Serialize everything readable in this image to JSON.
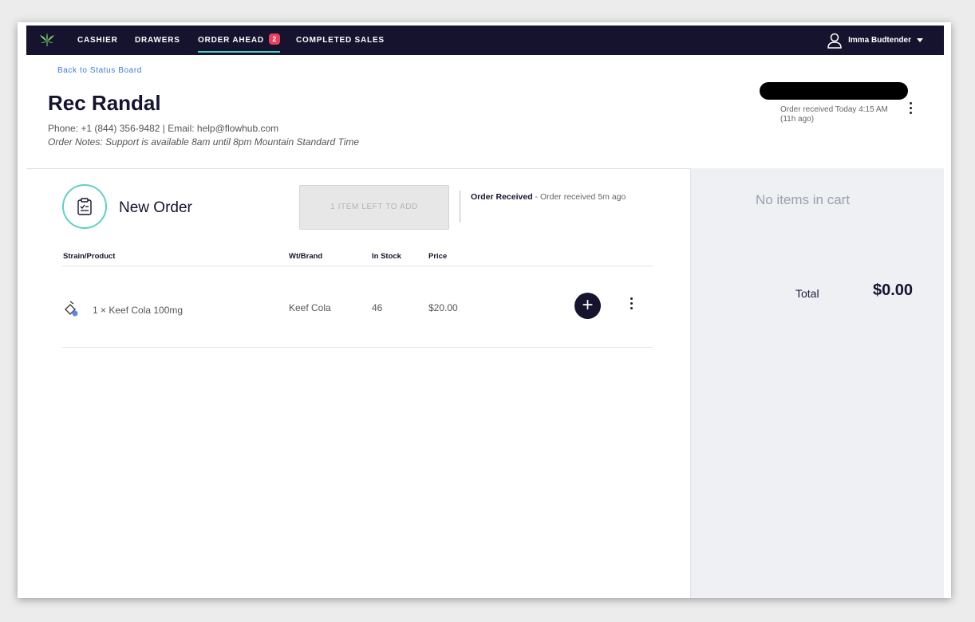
{
  "nav": {
    "items": [
      {
        "label": "CASHIER"
      },
      {
        "label": "DRAWERS"
      },
      {
        "label": "ORDER AHEAD",
        "badge": "2",
        "active": true
      },
      {
        "label": "COMPLETED SALES"
      }
    ],
    "user_name": "Imma Budtender"
  },
  "header": {
    "back_link": "Back to Status Board",
    "customer_name": "Rec Randal",
    "contact": "Phone: +1 (844) 356-9482  |  Email: help@flowhub.com",
    "notes": "Order Notes: Support is available 8am until 8pm Mountain Standard Time",
    "status_received": "Order received Today 4:15 AM (11h ago)"
  },
  "order": {
    "title": "New Order",
    "items_left_button": "1 ITEM LEFT TO ADD",
    "status_label": "Order Received",
    "status_detail": " - Order received 5m ago",
    "columns": [
      "Strain/Product",
      "Wt/Brand",
      "In Stock",
      "Price"
    ],
    "rows": [
      {
        "product": "1 × Keef Cola 100mg",
        "brand": "Keef Cola",
        "in_stock": "46",
        "price": "$20.00"
      }
    ]
  },
  "cart": {
    "empty_text": "No items in cart",
    "total_label": "Total",
    "total_value": "$0.00"
  },
  "colors": {
    "nav_bg": "#15132e",
    "accent_teal": "#4fd0bb",
    "badge_red": "#ea3f5e",
    "link_blue": "#3d7be0"
  }
}
